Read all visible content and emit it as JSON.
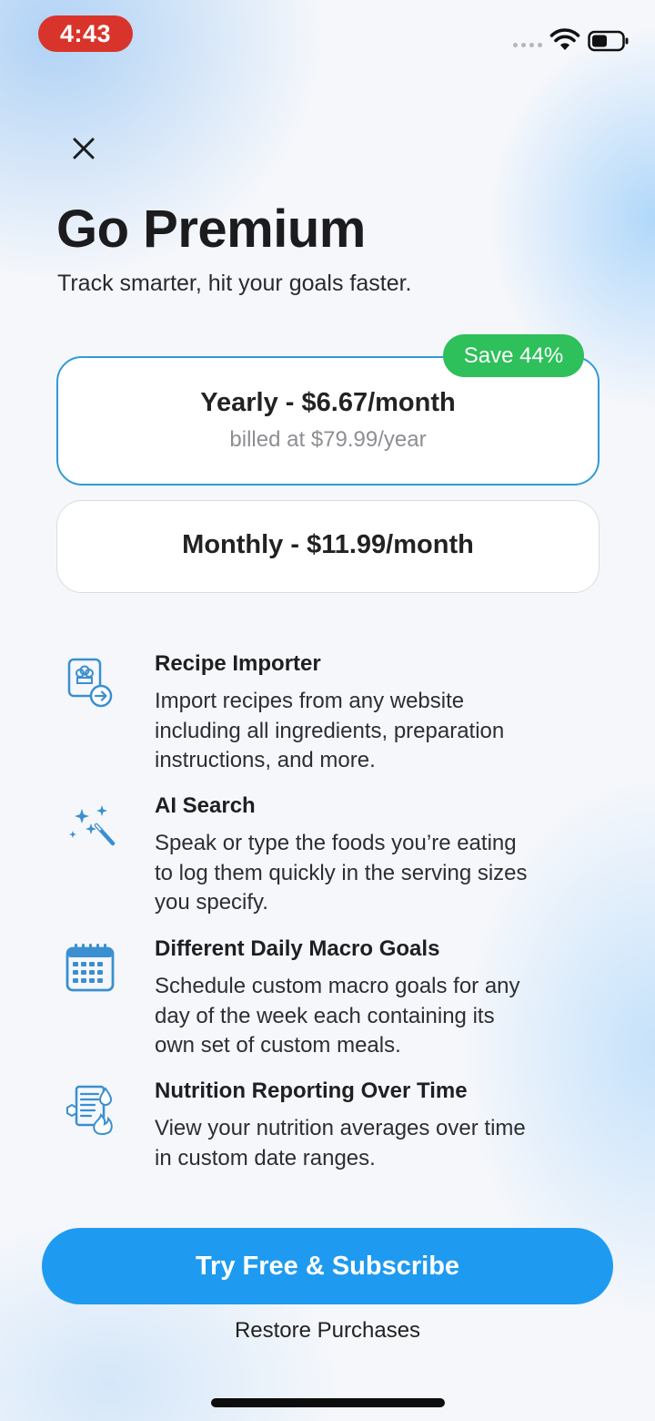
{
  "status_bar": {
    "time": "4:43"
  },
  "header": {
    "title": "Go Premium",
    "subtitle": "Track smarter, hit your goals faster."
  },
  "plans": [
    {
      "title": "Yearly - $6.67/month",
      "subtitle": "billed at $79.99/year",
      "badge": "Save 44%",
      "selected": true
    },
    {
      "title": "Monthly - $11.99/month",
      "selected": false
    }
  ],
  "features": [
    {
      "icon": "recipe-importer-icon",
      "title": "Recipe Importer",
      "lines": [
        "Import recipes from any website",
        "including all ingredients, preparation",
        "instructions, and more."
      ]
    },
    {
      "icon": "ai-sparkle-wand-icon",
      "title": "AI Search",
      "lines": [
        "Speak or type the foods you’re eating",
        "to log them quickly in the serving sizes",
        "you specify."
      ]
    },
    {
      "icon": "calendar-icon",
      "title": "Different Daily Macro Goals",
      "lines": [
        "Schedule custom macro goals for any",
        "day of the week each containing its",
        "own set of custom meals."
      ]
    },
    {
      "icon": "nutrition-report-icon",
      "title": "Nutrition Reporting Over Time",
      "lines": [
        "View your nutrition averages over time",
        "in custom date ranges."
      ]
    }
  ],
  "actions": {
    "cta_label": "Try Free & Subscribe",
    "restore_label": "Restore Purchases"
  },
  "colors": {
    "accent": "#1e9bf0",
    "selected_border": "#2f9bd6",
    "badge": "#2ec05a",
    "status_time_bg": "#d9342b",
    "icon_stroke": "#3a8fd0"
  }
}
